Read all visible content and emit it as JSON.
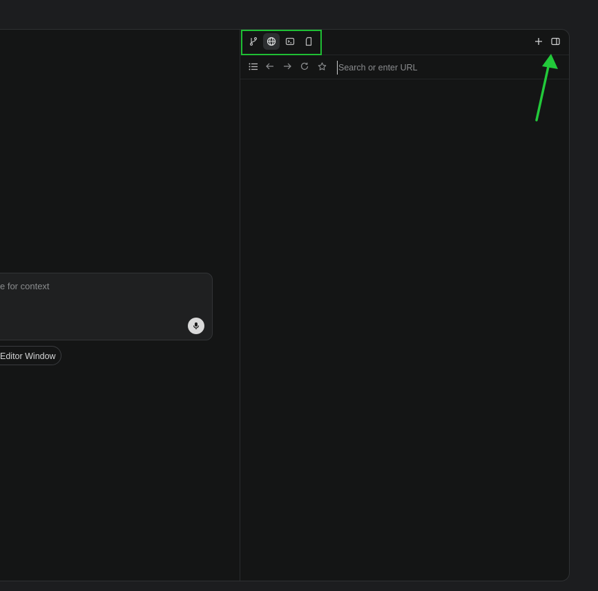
{
  "composer": {
    "placeholder": "e for context",
    "mic_icon": "microphone-icon"
  },
  "chips": {
    "editor_window": "Editor Window"
  },
  "browser": {
    "tabs": [
      {
        "icon": "git-branch-icon",
        "active": false
      },
      {
        "icon": "globe-icon",
        "active": true
      },
      {
        "icon": "terminal-icon",
        "active": false
      },
      {
        "icon": "file-icon",
        "active": false
      }
    ],
    "actions": [
      "plus-icon",
      "toggle-panel-icon"
    ],
    "url_bar": {
      "placeholder": "Search or enter URL",
      "value": ""
    }
  },
  "colors": {
    "highlight_box": "#1fbf34",
    "arrow": "#22c93a",
    "background": "#141515"
  }
}
